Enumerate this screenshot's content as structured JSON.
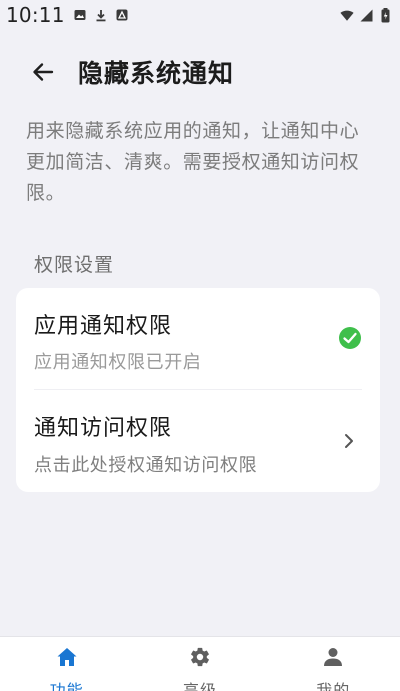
{
  "status_bar": {
    "time": "10:11",
    "icons": [
      "image-icon",
      "download-icon",
      "notification-icon",
      "wifi-icon",
      "signal-icon",
      "battery-icon"
    ]
  },
  "header": {
    "title": "隐藏系统通知",
    "back_icon": "arrow-left-icon"
  },
  "description": "用来隐藏系统应用的通知，让通知中心更加简洁、清爽。需要授权通知访问权限。",
  "section": {
    "title": "权限设置",
    "items": [
      {
        "title": "应用通知权限",
        "subtitle": "应用通知权限已开启",
        "icon": "check-circle-icon"
      },
      {
        "title": "通知访问权限",
        "subtitle": "点击此处授权通知访问权限",
        "icon": "chevron-right-icon"
      }
    ]
  },
  "bottom_nav": {
    "items": [
      {
        "label": "功能",
        "icon": "home-icon",
        "active": true
      },
      {
        "label": "高级",
        "icon": "gear-icon",
        "active": false
      },
      {
        "label": "我的",
        "icon": "person-icon",
        "active": false
      }
    ]
  },
  "colors": {
    "background": "#f1f1f6",
    "accent": "#1976d2",
    "success": "#3fbf4b"
  }
}
